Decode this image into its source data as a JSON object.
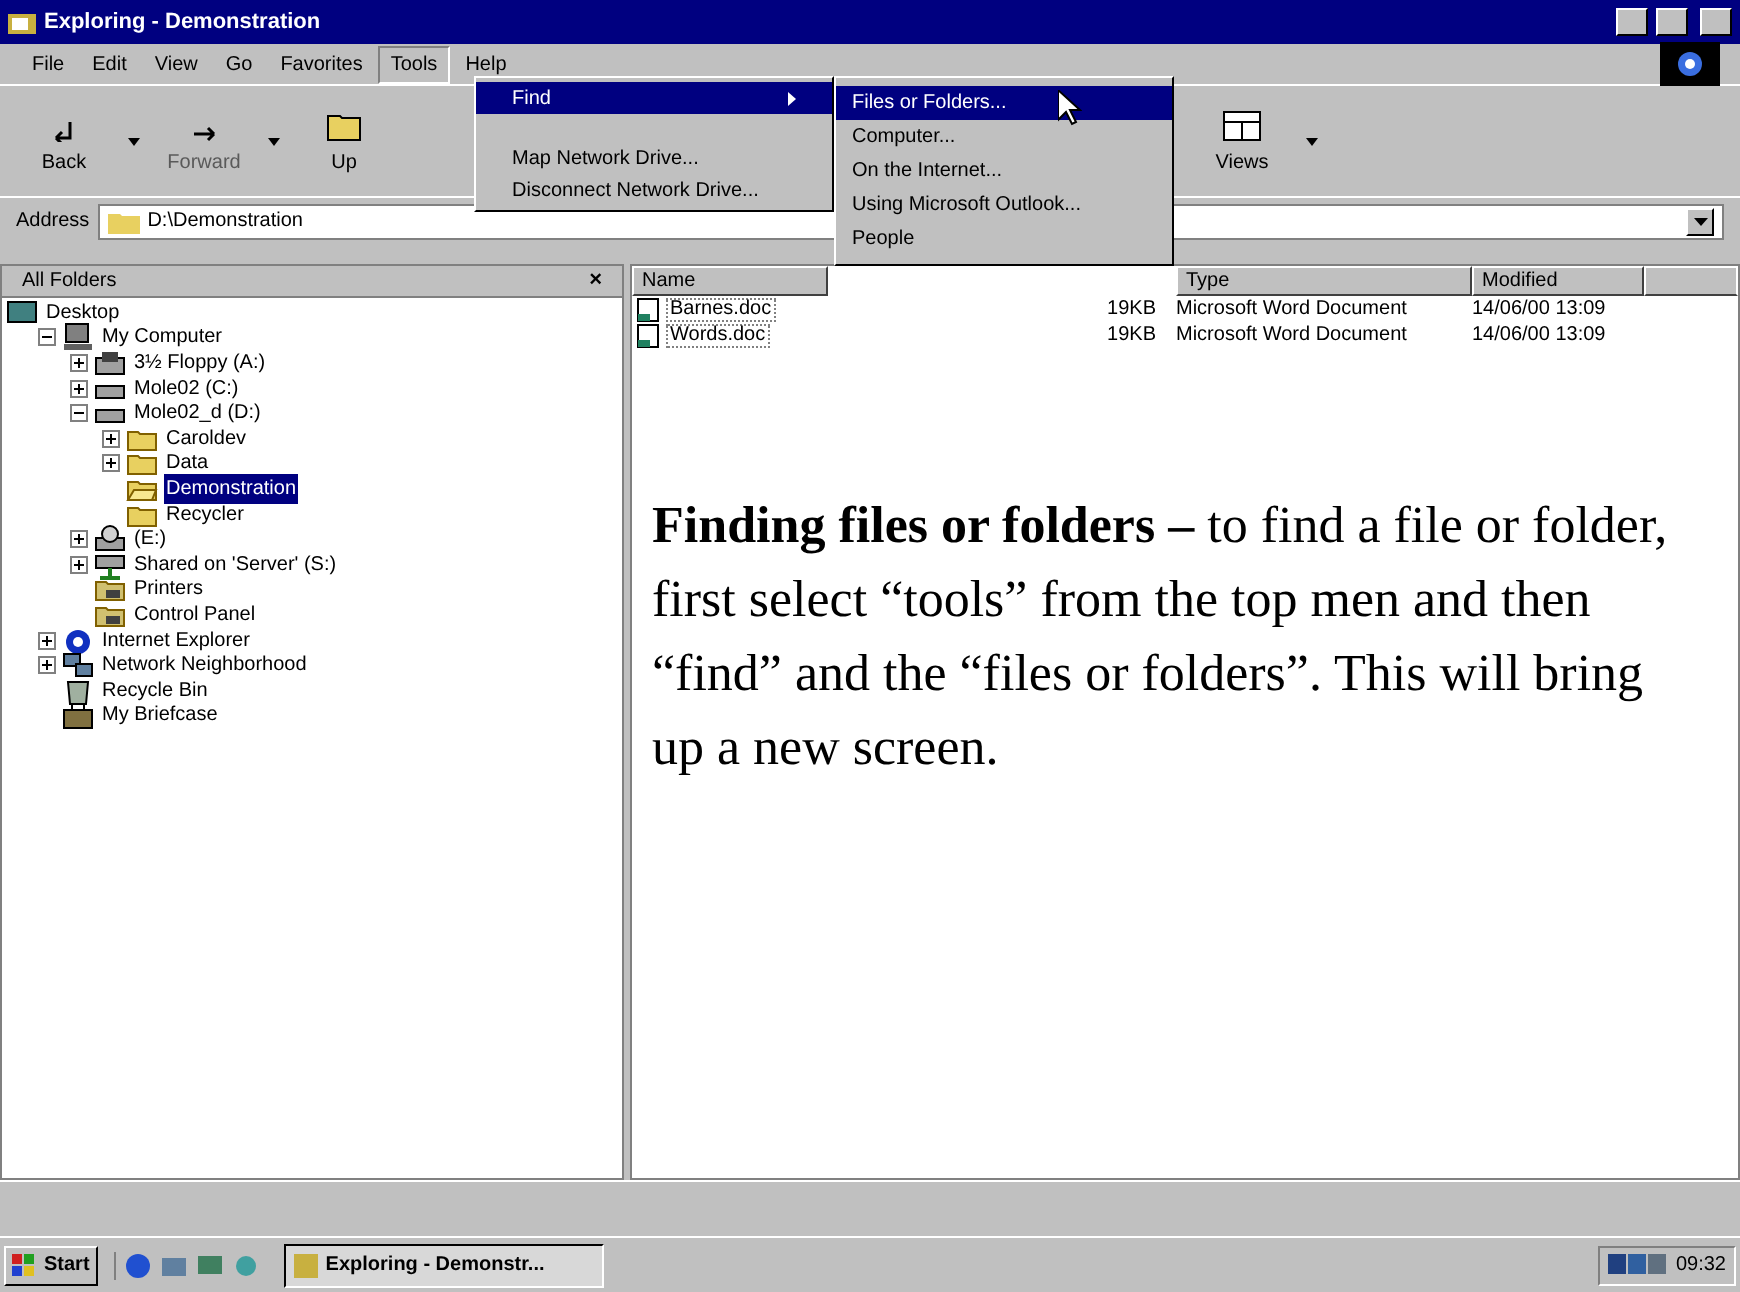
{
  "window": {
    "title": "Exploring - Demonstration"
  },
  "menu_bar": [
    {
      "label": "File",
      "selected": false
    },
    {
      "label": "Edit",
      "selected": false
    },
    {
      "label": "View",
      "selected": false
    },
    {
      "label": "Go",
      "selected": false
    },
    {
      "label": "Favorites",
      "selected": false
    },
    {
      "label": "Tools",
      "selected": true
    },
    {
      "label": "Help",
      "selected": false
    }
  ],
  "toolbar": [
    {
      "label": "Back",
      "disabled": false
    },
    {
      "label": "Forward",
      "disabled": true
    },
    {
      "label": "Up",
      "disabled": false
    },
    {
      "label": "Views",
      "disabled": false
    }
  ],
  "address": {
    "label": "Address",
    "value": "D:\\Demonstration"
  },
  "tools_menu": [
    {
      "label": "Find",
      "selected": true,
      "submenu": true
    },
    {
      "label": "Map Network Drive...",
      "selected": false,
      "submenu": false
    },
    {
      "label": "Disconnect Network Drive...",
      "selected": false,
      "submenu": false
    }
  ],
  "find_submenu": [
    {
      "label": "Files or Folders...",
      "selected": true
    },
    {
      "label": "Computer...",
      "selected": false
    },
    {
      "label": "On the Internet...",
      "selected": false
    },
    {
      "label": "Using Microsoft Outlook...",
      "selected": false
    },
    {
      "label": "People",
      "selected": false
    }
  ],
  "folders_pane": {
    "title": "All Folders",
    "close": "×",
    "tree": [
      {
        "label": "Desktop",
        "kind": "desktop",
        "children": [
          {
            "label": "My Computer",
            "kind": "computer",
            "expanded": true,
            "children": [
              {
                "label": "3½ Floppy (A:)",
                "kind": "floppy",
                "expanded": false
              },
              {
                "label": "Mole02 (C:)",
                "kind": "drive",
                "expanded": false
              },
              {
                "label": "Mole02_d (D:)",
                "kind": "drive",
                "expanded": true,
                "children": [
                  {
                    "label": "Caroldev",
                    "kind": "folder",
                    "expanded": false
                  },
                  {
                    "label": "Data",
                    "kind": "folder",
                    "expanded": false
                  },
                  {
                    "label": "Demonstration",
                    "kind": "openfolder",
                    "selected": true
                  },
                  {
                    "label": "Recycler",
                    "kind": "folder"
                  }
                ]
              },
              {
                "label": "(E:)",
                "kind": "cdrom",
                "expanded": false
              },
              {
                "label": "Shared on 'Server' (S:)",
                "kind": "netdrive",
                "expanded": false
              },
              {
                "label": "Printers",
                "kind": "printers"
              },
              {
                "label": "Control Panel",
                "kind": "printers"
              }
            ]
          },
          {
            "label": "Internet Explorer",
            "kind": "ie",
            "expanded": false
          },
          {
            "label": "Network Neighborhood",
            "kind": "network",
            "expanded": false
          },
          {
            "label": "Recycle Bin",
            "kind": "bin"
          },
          {
            "label": "My Briefcase",
            "kind": "briefcase"
          }
        ]
      }
    ]
  },
  "file_list": {
    "columns": [
      "Name",
      "Type",
      "Modified"
    ],
    "rows": [
      {
        "name": "Barnes.doc",
        "size": "19KB",
        "type": "Microsoft Word Document",
        "modified": "14/06/00 13:09"
      },
      {
        "name": "Words.doc",
        "size": "19KB",
        "type": "Microsoft Word Document",
        "modified": "14/06/00 13:09"
      }
    ]
  },
  "annotation": "**Finding files or folders –** to find a file or folder, first select “tools” from the top men and then “find” and the “files or folders”. This will bring up a new screen.",
  "taskbar": {
    "start": "Start",
    "task": "Exploring - Demonstr...",
    "clock": "09:32"
  }
}
